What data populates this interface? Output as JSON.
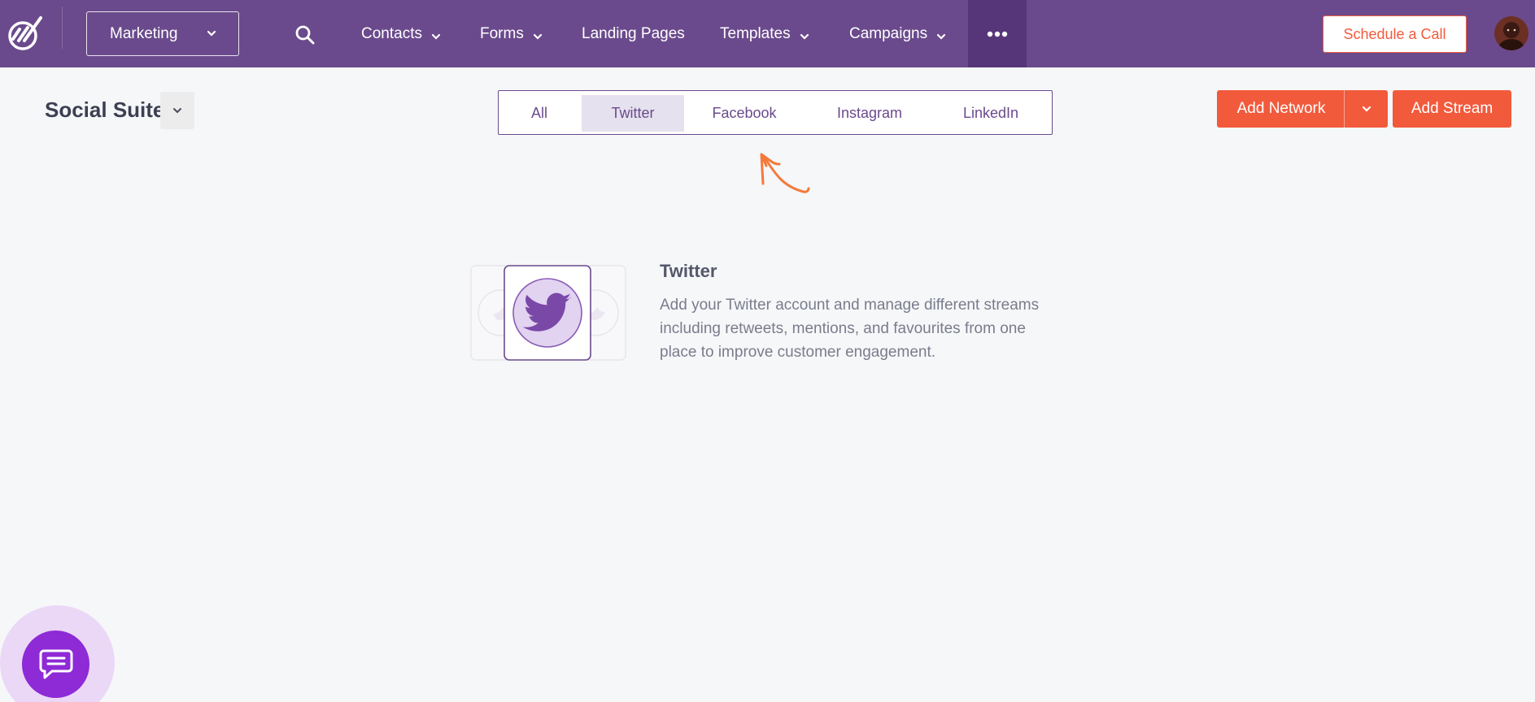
{
  "brand": {
    "logo_icon": "brand-logo-icon",
    "accent": "#6a4a8c",
    "cta": "#f25a3c"
  },
  "header": {
    "workspace": {
      "label": "Marketing",
      "icon": "chevron-down-icon"
    },
    "search_icon": "search-icon",
    "nav": {
      "contacts": "Contacts",
      "forms": "Forms",
      "landing_pages": "Landing Pages",
      "templates": "Templates",
      "campaigns": "Campaigns"
    },
    "more_icon": "more-dots-icon",
    "schedule_call": "Schedule a Call",
    "avatar_icon": "user-avatar"
  },
  "page": {
    "title": "Social Suite",
    "tabs": [
      {
        "label": "All",
        "active": false
      },
      {
        "label": "Twitter",
        "active": true
      },
      {
        "label": "Facebook",
        "active": false
      },
      {
        "label": "Instagram",
        "active": false
      },
      {
        "label": "LinkedIn",
        "active": false
      }
    ],
    "add_network": "Add Network",
    "add_stream": "Add Stream"
  },
  "empty_state": {
    "icon": "twitter-bird-icon",
    "title": "Twitter",
    "description": "Add your Twitter account and manage different streams including retweets, mentions, and favourites from one place to improve customer engagement."
  },
  "chat": {
    "icon": "chat-bubble-icon"
  }
}
